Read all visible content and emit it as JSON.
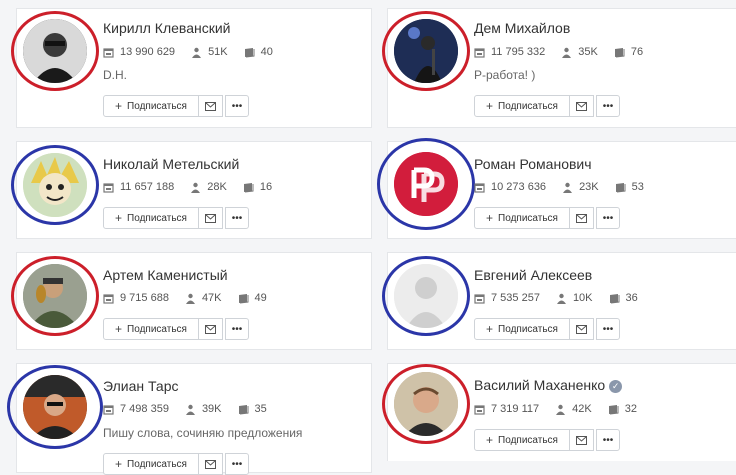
{
  "colors": {
    "ring_red": "#cc1f2a",
    "ring_blue": "#2b36a8",
    "accent_brand": "#d21d3c"
  },
  "icons": {
    "views": "calendar-icon",
    "subscribers": "person-icon",
    "posts": "book-icon",
    "message": "envelope-icon",
    "more": "ellipsis-icon"
  },
  "buttons": {
    "subscribe": "Подписаться",
    "subscribe_icon": "+",
    "more_glyph": "•••"
  },
  "profiles": [
    {
      "name": "Кирилл Клеванский",
      "views": "13 990 629",
      "subscribers": "51K",
      "posts": "40",
      "bio": "D.H.",
      "ring": "red",
      "verified": false
    },
    {
      "name": "Дем Михайлов",
      "views": "11 795 332",
      "subscribers": "35K",
      "posts": "76",
      "bio": "Р-работа! )",
      "ring": "red",
      "verified": false
    },
    {
      "name": "Николай Метельский",
      "views": "11 657 188",
      "subscribers": "28K",
      "posts": "16",
      "bio": "",
      "ring": "blue",
      "verified": false
    },
    {
      "name": "Роман Романович",
      "views": "10 273 636",
      "subscribers": "23K",
      "posts": "53",
      "bio": "",
      "ring": "blue",
      "verified": false
    },
    {
      "name": "Артем Каменистый",
      "views": "9 715 688",
      "subscribers": "47K",
      "posts": "49",
      "bio": "",
      "ring": "red",
      "verified": false
    },
    {
      "name": "Евгений Алексеев",
      "views": "7 535 257",
      "subscribers": "10K",
      "posts": "36",
      "bio": "",
      "ring": "blue",
      "verified": false
    },
    {
      "name": "Элиан Тарс",
      "views": "7 498 359",
      "subscribers": "39K",
      "posts": "35",
      "bio": "Пишу слова, сочиняю предложения",
      "ring": "blue",
      "verified": false
    },
    {
      "name": "Василий Маханенко",
      "views": "7 319 117",
      "subscribers": "42K",
      "posts": "32",
      "bio": "",
      "ring": "red",
      "verified": true
    }
  ]
}
